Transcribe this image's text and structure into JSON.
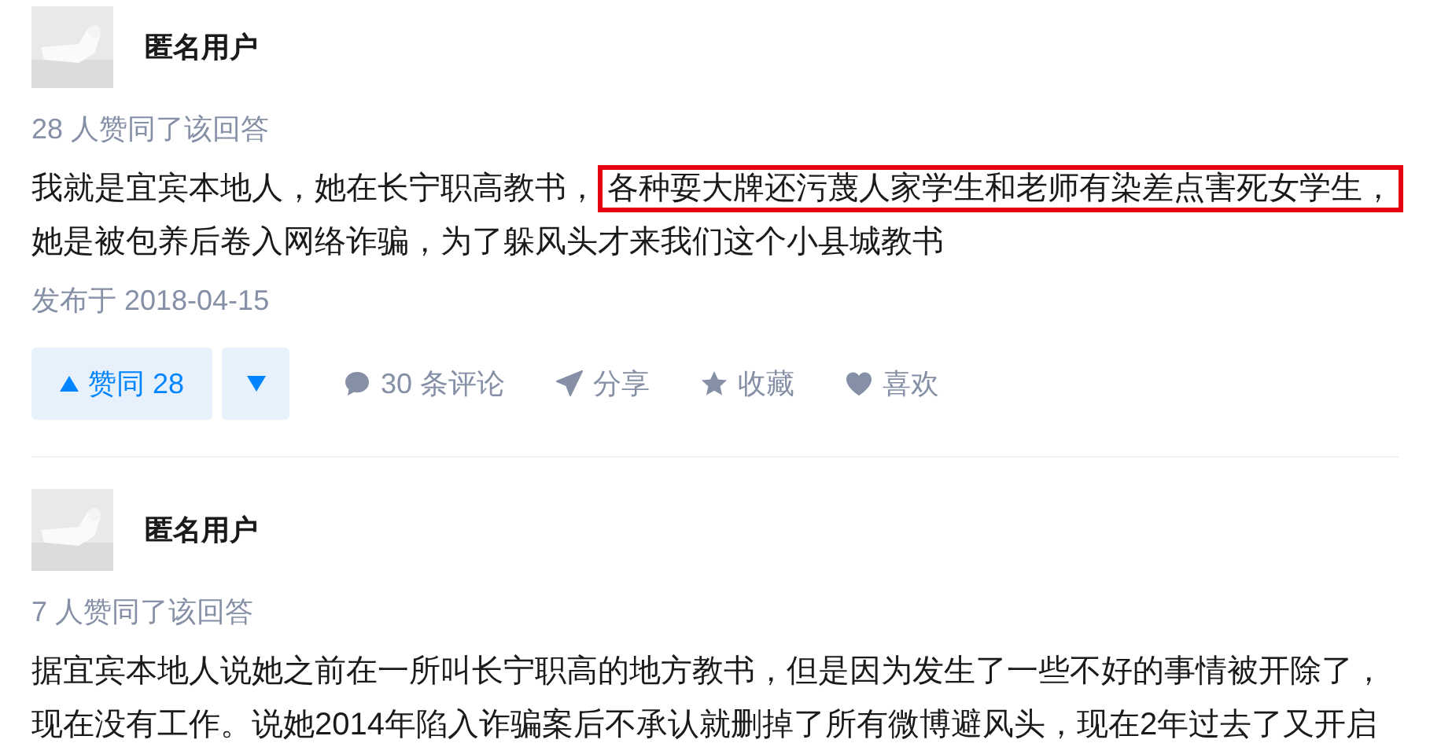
{
  "answers": [
    {
      "author": "匿名用户",
      "upvote_summary": "28 人赞同了该回答",
      "body_lines": [
        [
          {
            "text": "我就是宜宾本地人，她在长宁职高教书，",
            "highlighted": false
          },
          {
            "text": "各种耍大牌还污蔑人家学生和老师有染差点害死女学生，",
            "highlighted": true
          }
        ],
        [
          {
            "text": "她是被包养后卷入网络诈骗，为了躲风头才来我们这个小县城教书",
            "highlighted": false
          }
        ]
      ],
      "published": "发布于 2018-04-15",
      "upvote_button": "赞同 28",
      "actions": [
        {
          "kind": "comment",
          "label": "30 条评论"
        },
        {
          "kind": "share",
          "label": "分享"
        },
        {
          "kind": "favorite",
          "label": "收藏"
        },
        {
          "kind": "like",
          "label": "喜欢"
        }
      ]
    },
    {
      "author": "匿名用户",
      "upvote_summary": "7 人赞同了该回答",
      "body_lines": [
        [
          {
            "text": "据宜宾本地人说她之前在一所叫长宁职高的地方教书，但是因为发生了一些不好的事情被开除了，",
            "highlighted": false
          }
        ],
        [
          {
            "text": "现在没有工作。说她2014年陷入诈骗案后不承认就删掉了所有微博避风头，现在2年过去了又开启",
            "highlighted": false
          }
        ]
      ]
    }
  ]
}
